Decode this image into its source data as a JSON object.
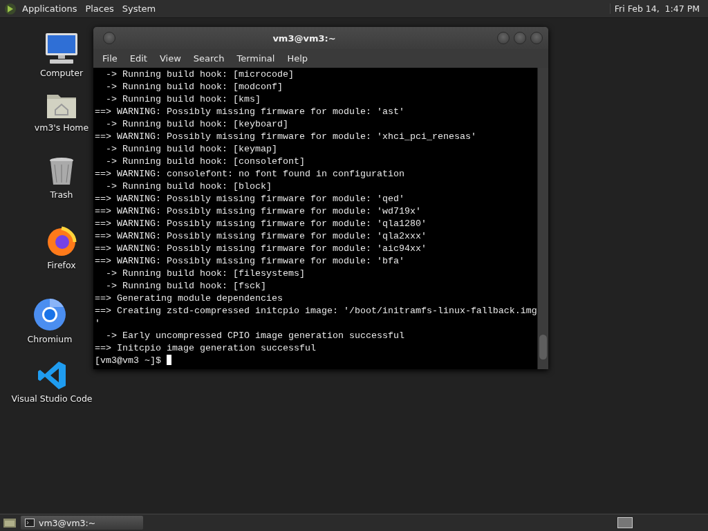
{
  "top_panel": {
    "menus": [
      "Applications",
      "Places",
      "System"
    ],
    "clock": "Fri Feb 14,  1:47 PM"
  },
  "desktop_icons": [
    {
      "kind": "computer",
      "label": "Computer"
    },
    {
      "kind": "home",
      "label": "vm3's Home"
    },
    {
      "kind": "trash",
      "label": "Trash"
    },
    {
      "kind": "firefox",
      "label": "Firefox"
    },
    {
      "kind": "chromium",
      "label": "Chromium"
    },
    {
      "kind": "vscode",
      "label": "Visual Studio Code"
    }
  ],
  "window": {
    "title": "vm3@vm3:~",
    "menu": [
      "File",
      "Edit",
      "View",
      "Search",
      "Terminal",
      "Help"
    ],
    "terminal_lines": [
      "  -> Running build hook: [microcode]",
      "  -> Running build hook: [modconf]",
      "  -> Running build hook: [kms]",
      "==> WARNING: Possibly missing firmware for module: 'ast'",
      "  -> Running build hook: [keyboard]",
      "==> WARNING: Possibly missing firmware for module: 'xhci_pci_renesas'",
      "  -> Running build hook: [keymap]",
      "  -> Running build hook: [consolefont]",
      "==> WARNING: consolefont: no font found in configuration",
      "  -> Running build hook: [block]",
      "==> WARNING: Possibly missing firmware for module: 'qed'",
      "==> WARNING: Possibly missing firmware for module: 'wd719x'",
      "==> WARNING: Possibly missing firmware for module: 'qla1280'",
      "==> WARNING: Possibly missing firmware for module: 'qla2xxx'",
      "==> WARNING: Possibly missing firmware for module: 'aic94xx'",
      "==> WARNING: Possibly missing firmware for module: 'bfa'",
      "  -> Running build hook: [filesystems]",
      "  -> Running build hook: [fsck]",
      "==> Generating module dependencies",
      "==> Creating zstd-compressed initcpio image: '/boot/initramfs-linux-fallback.img",
      "'",
      "  -> Early uncompressed CPIO image generation successful",
      "==> Initcpio image generation successful"
    ],
    "prompt": "[vm3@vm3 ~]$ "
  },
  "taskbar": {
    "tasks": [
      {
        "label": "vm3@vm3:~",
        "selected": true
      }
    ]
  }
}
